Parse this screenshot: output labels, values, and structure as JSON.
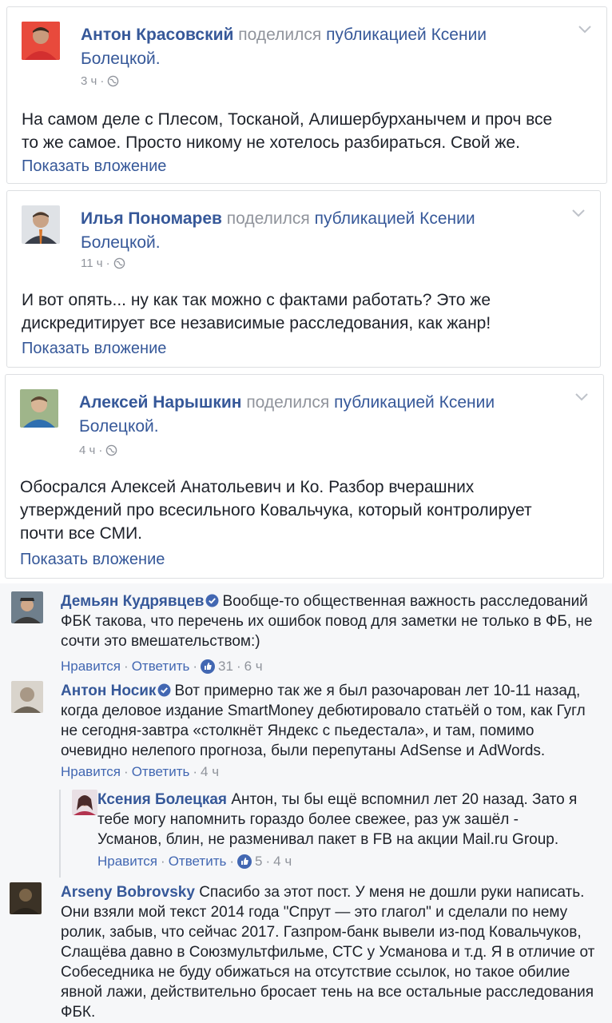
{
  "posts": [
    {
      "author": "Антон Красовский",
      "action": "поделился",
      "shared": "публикацией Ксении",
      "shared2": "Болецкой.",
      "time": "3 ч",
      "dot": "·",
      "text1": "На самом деле с Плесом, Тосканой, Алишербурханычем и проч все",
      "text2": "то же самое. Просто никому не хотелось разбираться. Свой же.",
      "text3": "",
      "show": "Показать вложение"
    },
    {
      "author": "Илья Пономарев",
      "action": "поделился",
      "shared": "публикацией Ксении",
      "shared2": "Болецкой.",
      "time": "11 ч",
      "dot": "·",
      "text1": "И вот опять... ну как так можно с фактами работать? Это же",
      "text2": "дискредитирует все независимые расследования, как жанр!",
      "text3": "",
      "show": "Показать вложение"
    },
    {
      "author": "Алексей Нарышкин",
      "action": "поделился",
      "shared": "публикацией Ксении",
      "shared2": "Болецкой.",
      "time": "4 ч",
      "dot": "·",
      "text1": "Обосрался Алексей Анатольевич и Ко. Разбор вчерашних",
      "text2": "утверждений про всесильного Ковальчука, который контролирует",
      "text3": "почти все СМИ.",
      "show": "Показать вложение"
    }
  ],
  "comments": [
    {
      "author": "Демьян Кудрявцев",
      "lines": [
        "Вообще-то общественная важность расследований",
        "ФБК такова, что перечень их ошибок повод для заметки не только в ФБ, не",
        "сочти это вмешательством:)"
      ],
      "like": "Нравится",
      "reply": "Ответить",
      "count": "31",
      "time": "6 ч"
    },
    {
      "author": "Антон Носик",
      "lines": [
        "Вот примерно так же я был разочарован лет 10-11 назад,",
        "когда деловое издание SmartMoney дебютировало статьёй о том, как Гугл",
        "не сегодня-завтра «столкнёт Яндекс с пьедестала», и там, помимо",
        "очевидно нелепого прогноза, были перепутаны AdSense и AdWords."
      ],
      "like": "Нравится",
      "reply": "Ответить",
      "time": "4 ч"
    },
    {
      "author": "Ксения Болецкая",
      "lines": [
        "Антон, ты бы ещё вспомнил лет 20 назад. Зато я",
        "тебе могу напомнить гораздо более свежее, раз уж зашёл -",
        "Усманов, блин, не разменивал пакет в FB на акции Mail.ru Group."
      ],
      "like": "Нравится",
      "reply": "Ответить",
      "count": "5",
      "time": "4 ч"
    },
    {
      "author": "Arseny Bobrovsky",
      "lines": [
        "Спасибо за этот пост. У меня не дошли руки написать.",
        "Они взяли мой текст 2014 года \"Спрут — это глагол\" и сделали по нему",
        "ролик, забыв, что сейчас 2017. Газпром-банк вывели из-под Ковальчуков,",
        "Слащёва давно в Союзмультфильме, СТС у Усманова и т.д. Я в отличие от",
        "Собеседника не буду обижаться на отсутствие ссылок, но такое обилие",
        "явной лажи, действительно бросает тень на все остальные расследования",
        "ФБК."
      ]
    }
  ],
  "sep": "·"
}
